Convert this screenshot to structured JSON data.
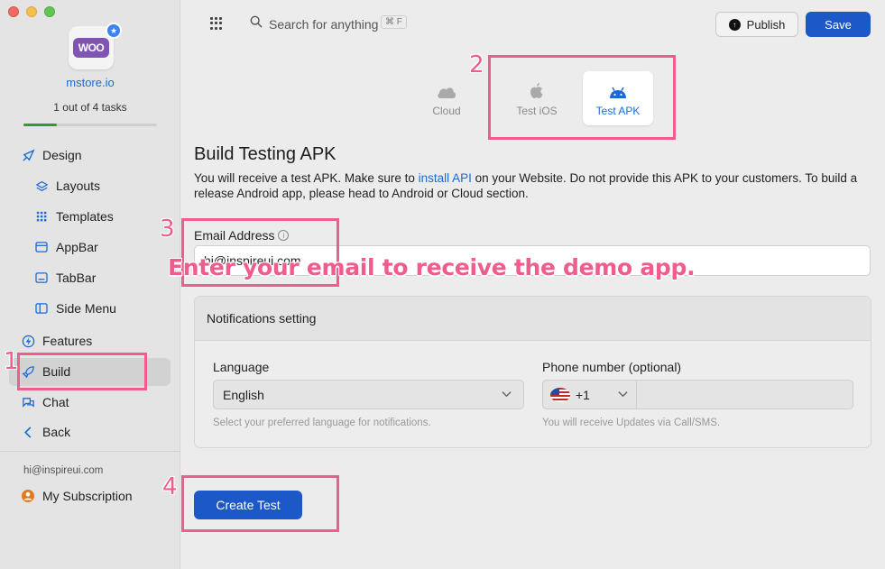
{
  "window": {
    "controls": [
      "close",
      "minimize",
      "zoom"
    ]
  },
  "sidebar": {
    "store_logo_text": "WOO",
    "store_badge_icon": "star-icon",
    "store_name": "mstore.io",
    "task_progress_label": "1 out of 4 tasks",
    "task_progress_fraction": 0.25,
    "nav": {
      "design": "Design",
      "layouts": "Layouts",
      "templates": "Templates",
      "appbar": "AppBar",
      "tabbar": "TabBar",
      "side_menu": "Side Menu",
      "features": "Features",
      "build": "Build",
      "chat": "Chat",
      "back": "Back"
    },
    "user_email": "hi@inspireui.com",
    "subscription": "My Subscription"
  },
  "topbar": {
    "search_placeholder": "Search for anything",
    "search_shortcut": "⌘ F",
    "publish_label": "Publish",
    "save_label": "Save"
  },
  "platform_tabs": {
    "cloud": "Cloud",
    "ios": "Test iOS",
    "apk": "Test APK",
    "selected": "Test APK"
  },
  "build": {
    "title": "Build Testing APK",
    "desc_before_link": "You will receive a test APK. Make sure to ",
    "desc_link": "install API",
    "desc_after_link": " on your Website. Do not provide this APK to your customers. To build a release Android app, please head to Android or Cloud section.",
    "email_label": "Email Address",
    "email_value": "hi@inspireui.com",
    "overlay_note": "Enter your email to receive the demo app."
  },
  "notifications": {
    "header": "Notifications setting",
    "language_label": "Language",
    "language_value": "English",
    "language_help": "Select your preferred language for notifications.",
    "phone_label": "Phone number (optional)",
    "phone_code": "+1",
    "phone_help": "You will receive Updates via Call/SMS."
  },
  "create_test_label": "Create Test",
  "annotations": {
    "n1": "1",
    "n2": "2",
    "n3": "3",
    "n4": "4",
    "color": "#ef5d8c"
  },
  "colors": {
    "accent": "#1d58c8",
    "link": "#1a6bd6",
    "progress": "#2a9d3a"
  }
}
